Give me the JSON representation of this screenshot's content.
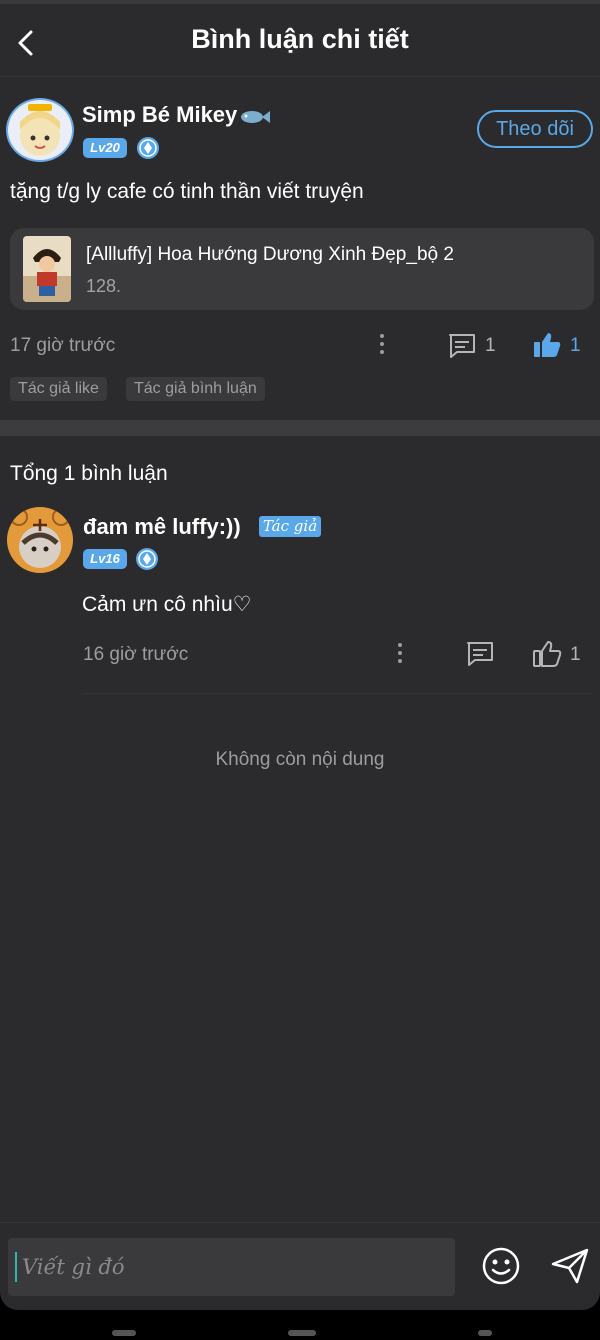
{
  "header": {
    "title": "Bình luận chi tiết"
  },
  "post": {
    "username": "Simp Bé Mikey",
    "level": "Lv20",
    "follow_label": "Theo dõi",
    "text": "tặng t/g ly cafe có tinh thần viết truyện",
    "book": {
      "title": "[Allluffy] Hoa Hướng Dương Xinh Đẹp_bộ 2",
      "subtitle": "128."
    },
    "time": "17 giờ trước",
    "comment_count": "1",
    "like_count": "1",
    "tags": [
      "Tác giả like",
      "Tác giả bình luận"
    ]
  },
  "comments_section": {
    "total_label": "Tổng 1 bình luận",
    "comments": [
      {
        "username": "đam mê luffy:))",
        "author_badge": "Tác giả",
        "level": "Lv16",
        "text": "Cảm ưn cô nhìu♡",
        "time": "16 giờ trước",
        "like_count": "1"
      }
    ],
    "end_label": "Không còn nội dung"
  },
  "composer": {
    "placeholder": "Viết gì đó"
  },
  "colors": {
    "accent": "#5aa7ea",
    "background": "#2b2b2d",
    "card": "#3a3a3c"
  }
}
